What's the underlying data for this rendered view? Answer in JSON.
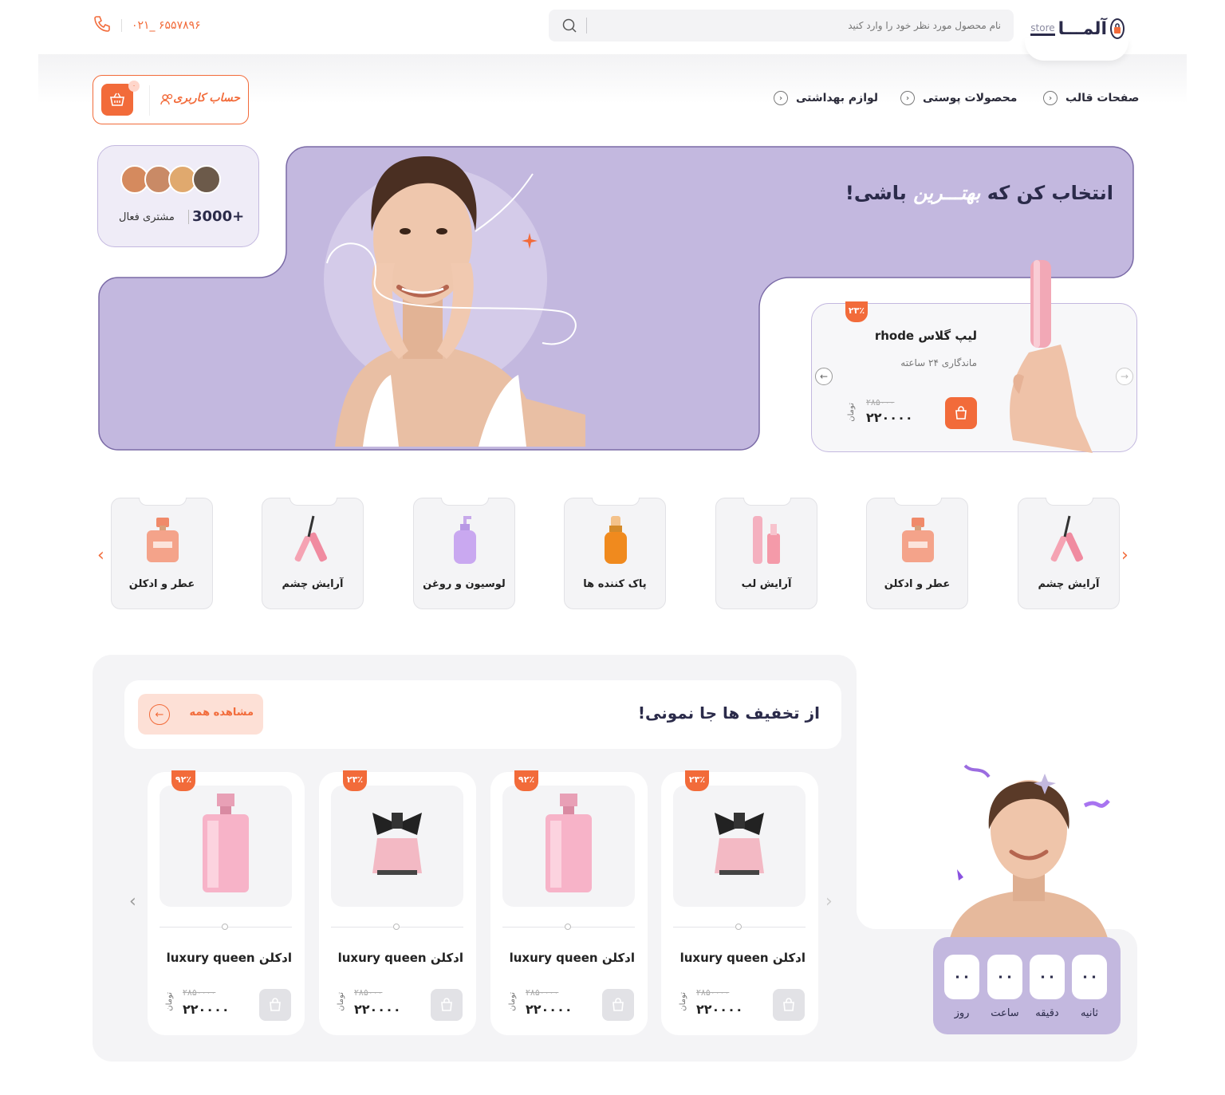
{
  "header": {
    "logo_brand": "آلمـــا",
    "logo_store": "store",
    "search_placeholder": "نام محصول مورد نظر خود را وارد کنید",
    "phone": "۰۲۱_ ۶۵۵۷۸۹۶",
    "nav": [
      {
        "label": "صفحات قالب"
      },
      {
        "label": "محصولات پوستی"
      },
      {
        "label": "لوازم بهداشتی"
      }
    ],
    "account_label": "حساب کاربری",
    "cart_count": "۰"
  },
  "colors": {
    "accent": "#f26b3a",
    "lavender": "#c3b8df",
    "dark": "#2b2b4a"
  },
  "hero": {
    "customers_count": "3000+",
    "customers_label": "مشتری فعال",
    "headline_start": "انتخاب کن که",
    "headline_highlight": "بهتـــرین",
    "headline_end": "باشی!",
    "product": {
      "badge": "۲۳٪",
      "title": "لیپ گلاس rhode",
      "subtitle": "ماندگاری ۲۴ ساعته",
      "old_price": "۲۸۵۰۰۰",
      "price": "۲۲۰۰۰۰",
      "currency": "تومان"
    }
  },
  "categories": [
    {
      "label": "آرایش چشم",
      "icon": "mascara-icon"
    },
    {
      "label": "عطر و ادکلن",
      "icon": "perfume-icon"
    },
    {
      "label": "آرایش لب",
      "icon": "lipgloss-icon"
    },
    {
      "label": "پاک کننده ها",
      "icon": "serum-icon"
    },
    {
      "label": "لوسیون و روغن",
      "icon": "lotion-icon"
    },
    {
      "label": "آرایش چشم",
      "icon": "mascara-icon"
    },
    {
      "label": "عطر و ادکلن",
      "icon": "perfume-icon"
    }
  ],
  "discount": {
    "title": "از تخفیف ها جا نمونی!",
    "see_all": "مشاهده همه",
    "products": [
      {
        "badge": "۲۳٪",
        "name": "ادکلن luxury queen",
        "old_price": "۲۸۵۰۰۰۰",
        "price": "۲۲۰۰۰۰",
        "currency": "تومان",
        "image": "black-bow-perfume"
      },
      {
        "badge": "۹۲٪",
        "name": "ادکلن luxury queen",
        "old_price": "۲۸۵۰۰۰۰",
        "price": "۲۲۰۰۰۰",
        "currency": "تومان",
        "image": "pink-perfume"
      },
      {
        "badge": "۲۳٪",
        "name": "ادکلن luxury queen",
        "old_price": "۲۸۵۰۰۰",
        "price": "۲۲۰۰۰۰",
        "currency": "تومان",
        "image": "black-bow-perfume"
      },
      {
        "badge": "۹۲٪",
        "name": "ادکلن luxury queen",
        "old_price": "۲۸۵۰۰۰۰",
        "price": "۲۲۰۰۰۰",
        "currency": "تومان",
        "image": "pink-perfume"
      }
    ]
  },
  "countdown": {
    "seconds": "۰۰",
    "seconds_label": "ثانیه",
    "minutes": "۰۰",
    "minutes_label": "دقیقه",
    "hours": "۰۰",
    "hours_label": "ساعت",
    "days": "۰۰",
    "days_label": "روز"
  }
}
